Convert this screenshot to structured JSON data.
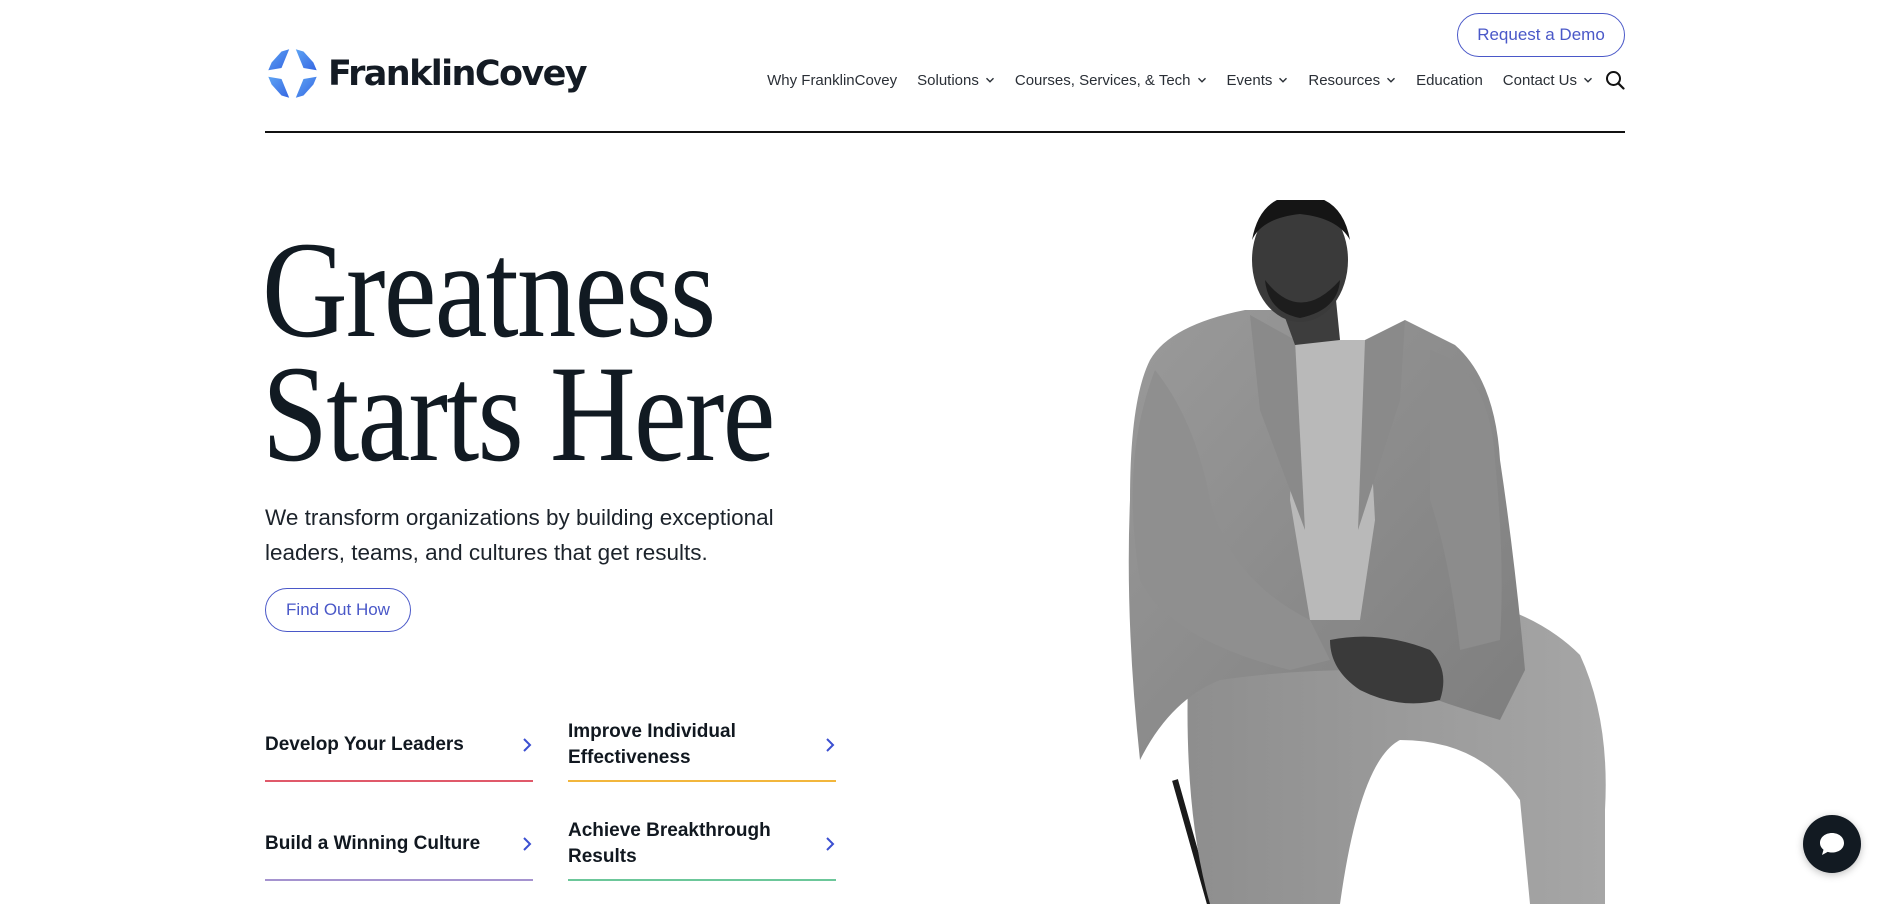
{
  "brand": {
    "name": "FranklinCovey",
    "logo_icon": "four-point-star-logo-icon",
    "colors": {
      "logo_blue_light": "#5a9cf2",
      "logo_blue_dark": "#3a6fe6",
      "accent": "#4a58c8",
      "text_dark": "#111a22"
    }
  },
  "header": {
    "cta_label": "Request a Demo",
    "nav": [
      {
        "label": "Why FranklinCovey",
        "has_dropdown": false
      },
      {
        "label": "Solutions",
        "has_dropdown": true
      },
      {
        "label": "Courses, Services, & Tech",
        "has_dropdown": true
      },
      {
        "label": "Events",
        "has_dropdown": true
      },
      {
        "label": "Resources",
        "has_dropdown": true
      },
      {
        "label": "Education",
        "has_dropdown": false
      },
      {
        "label": "Contact Us",
        "has_dropdown": true
      }
    ],
    "search_icon": "search-icon"
  },
  "hero": {
    "headline_line1": "Greatness",
    "headline_line2": "Starts Here",
    "subtext": "We transform organizations by building exceptional leaders, teams, and cultures that get results.",
    "cta_label": "Find Out How",
    "image_alt": "Man in gray suit seated on a stool, black and white photo"
  },
  "cards": [
    {
      "label": "Develop Your Leaders",
      "color": "#e0596a"
    },
    {
      "label": "Improve Individual Effectiveness",
      "color": "#f2b63c"
    },
    {
      "label": "Build a Winning Culture",
      "color": "#a593cf"
    },
    {
      "label": "Achieve Breakthrough Results",
      "color": "#6cc79a"
    }
  ],
  "chat": {
    "icon": "chat-bubble-icon"
  }
}
